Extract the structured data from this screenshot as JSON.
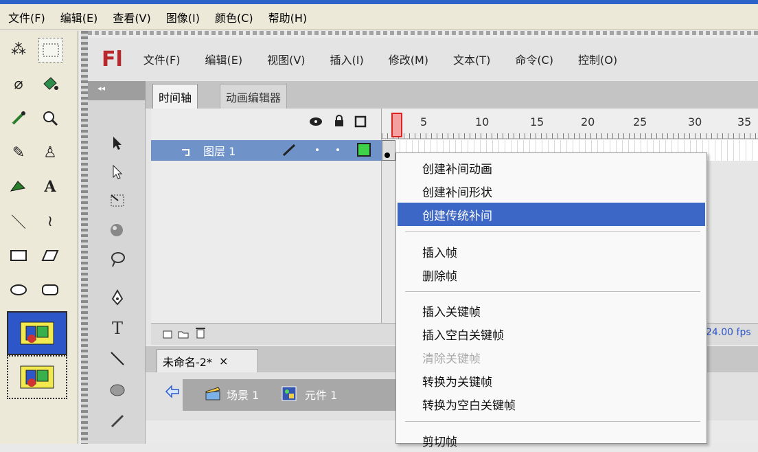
{
  "outer_menu": [
    "文件(F)",
    "编辑(E)",
    "查看(V)",
    "图像(I)",
    "颜色(C)",
    "帮助(H)"
  ],
  "flash": {
    "logo": "Fl",
    "menu": [
      "文件(F)",
      "编辑(E)",
      "视图(V)",
      "插入(I)",
      "修改(M)",
      "文本(T)",
      "命令(C)",
      "控制(O)"
    ],
    "tools_collapse": "◂◂",
    "text_tool": "T"
  },
  "timeline": {
    "tabs": [
      "时间轴",
      "动画编辑器"
    ],
    "frame_numbers": [
      "5",
      "10",
      "15",
      "20",
      "25",
      "30",
      "35"
    ],
    "layer_name": "图层 1",
    "fps": "24.00 fps"
  },
  "document": {
    "tab_label": "未命名-2*",
    "tab_close": "×",
    "scene": "场景 1",
    "symbol": "元件 1"
  },
  "context_menu": {
    "items": [
      "创建补间动画",
      "创建补间形状",
      "创建传统补间",
      "插入帧",
      "删除帧",
      "插入关键帧",
      "插入空白关键帧",
      "清除关键帧",
      "转换为关键帧",
      "转换为空白关键帧",
      "剪切帧"
    ],
    "highlighted": "创建传统补间",
    "disabled": "清除关键帧"
  },
  "colors": {
    "highlight": "#3d67c6",
    "layer_row": "#6f93c9",
    "playhead": "#f4a0a0",
    "logo": "#b8272b",
    "fps": "#2b53c6"
  }
}
